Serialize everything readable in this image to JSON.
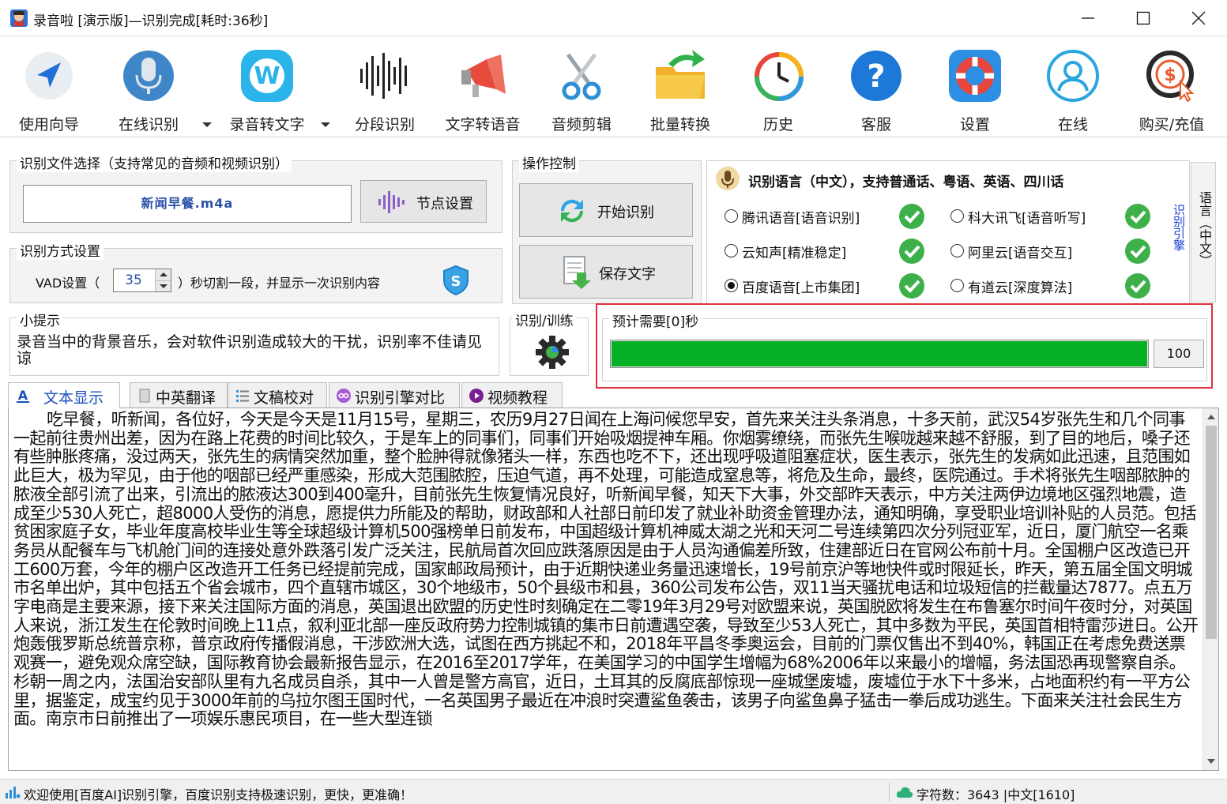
{
  "window": {
    "title": "录音啦 [演示版]—识别完成[耗时:36秒]"
  },
  "toolbar": {
    "items": [
      {
        "label": "使用向导",
        "icon": "navigation-arrow-icon"
      },
      {
        "label": "在线识别",
        "icon": "microphone-icon"
      },
      {
        "label": "录音转文字",
        "icon": "w-badge-icon"
      },
      {
        "label": "分段识别",
        "icon": "sound-wave-icon"
      },
      {
        "label": "文字转语音",
        "icon": "megaphone-icon"
      },
      {
        "label": "音频剪辑",
        "icon": "scissors-icon"
      },
      {
        "label": "批量转换",
        "icon": "folder-arrow-icon"
      },
      {
        "label": "历史",
        "icon": "history-clock-icon"
      },
      {
        "label": "客服",
        "icon": "help-question-icon"
      },
      {
        "label": "设置",
        "icon": "lifebuoy-icon"
      },
      {
        "label": "在线",
        "icon": "user-icon"
      },
      {
        "label": "购买/充值",
        "icon": "dollar-coin-icon"
      }
    ]
  },
  "file_group": {
    "title": "识别文件选择（支持常见的音频和视频识别）",
    "file_name": "新闻早餐.m4a",
    "node_button": "节点设置"
  },
  "control_group": {
    "title": "操作控制",
    "start_button": "开始识别",
    "save_button": "保存文字"
  },
  "method_group": {
    "title": "识别方式设置",
    "vad_prefix": "VAD设置（",
    "vad_value": "35",
    "vad_suffix": "）秒切割一段，并显示一次识别内容"
  },
  "tip_group": {
    "title": "小提示",
    "text": "录音当中的背景音乐，会对软件识别造成较大的干扰，识别率不佳请见谅"
  },
  "train_group": {
    "title": "识别/训练"
  },
  "language": {
    "header": "识别语言（中文），支持普通话、粤语、英语、四川话",
    "side_tab": "语言（中文）",
    "side_link": "识别引擎",
    "engines": [
      {
        "label": "腾讯语音[语音识别]",
        "selected": false,
        "available": true
      },
      {
        "label": "科大讯飞[语音听写]",
        "selected": false,
        "available": true
      },
      {
        "label": "云知声[精准稳定]",
        "selected": false,
        "available": true
      },
      {
        "label": "阿里云[语音交互]",
        "selected": false,
        "available": true
      },
      {
        "label": "百度语音[上市集团]",
        "selected": true,
        "available": true
      },
      {
        "label": "有道云[深度算法]",
        "selected": false,
        "available": true
      }
    ]
  },
  "progress": {
    "title": "预计需要[0]秒",
    "value": 100,
    "value_text": "100",
    "color": "#06b025"
  },
  "tabs": [
    {
      "label": "文本显示",
      "icon": "text-a-icon",
      "active": true
    },
    {
      "label": "中英翻译",
      "icon": "translate-doc-icon",
      "active": false
    },
    {
      "label": "文稿校对",
      "icon": "list-check-icon",
      "active": false
    },
    {
      "label": "识别引擎对比",
      "icon": "infinity-icon",
      "active": false
    },
    {
      "label": "视频教程",
      "icon": "play-circle-icon",
      "active": false
    }
  ],
  "result_text": "吃早餐，听新闻，各位好，今天是今天是11月15号，星期三，农历9月27日闻在上海问候您早安，首先来关注头条消息，十多天前，武汉54岁张先生和几个同事一起前往贵州出差，因为在路上花费的时间比较久，于是车上的同事们，同事们开始吸烟提神车厢。你烟雾缭绕，而张先生喉咙越来越不舒服，到了目的地后，嗓子还有些肿胀疼痛，没过两天，张先生的病情突然加重，整个脸肿得就像猪头一样，东西也吃不下，还出现呼吸道阻塞症状，医生表示，张先生的发病如此迅速，且范围如此巨大，极为罕见，由于他的咽部已经严重感染，形成大范围脓腔，压迫气道，再不处理，可能造成窒息等，将危及生命，最终，医院通过。手术将张先生咽部脓肿的脓液全部引流了出来，引流出的脓液达300到400毫升，目前张先生恢复情况良好，听新闻早餐，知天下大事，外交部昨天表示，中方关注两伊边境地区强烈地震，造成至少530人死亡，超8000人受伤的消息，愿提供力所能及的帮助，财政部和人社部日前印发了就业补助资金管理办法，通知明确，享受职业培训补贴的人员范。包括贫困家庭子女，毕业年度高校毕业生等全球超级计算机500强榜单日前发布，中国超级计算机神威太湖之光和天河二号连续第四次分列冠亚军，近日，厦门航空一名乘务员从配餐车与飞机舱门间的连接处意外跌落引发广泛关注，民航局首次回应跌落原因是由于人员沟通偏差所致，住建部近日在官网公布前十月。全国棚户区改造已开工600万套，今年的棚户区改造开工任务已经提前完成，国家邮政局预计，由于近期快递业务量迅速增长，19号前京沪等地快件或时限延长，昨天，第五届全国文明城市名单出炉，其中包括五个省会城市，四个直辖市城区，30个地级市，50个县级市和县，360公司发布公告，双11当天骚扰电话和垃圾短信的拦截量达7877。点五万字电商是主要来源，接下来关注国际方面的消息，英国退出欧盟的历史性时刻确定在二零19年3月29号对欧盟来说，英国脱欧将发生在布鲁塞尔时间午夜时分，对英国人来说，浙江发生在伦敦时间晚上11点，叙利亚北部一座反政府势力控制城镇的集市日前遭遇空袭，导致至少53人死亡，其中多数为平民，英国首相特雷莎进日。公开炮轰俄罗斯总统普京称，普京政府传播假消息，干涉欧洲大选，试图在西方挑起不和，2018年平昌冬季奥运会，目前的门票仅售出不到40%，韩国正在考虑免费送票观赛一，避免观众席空缺，国际教育协会最新报告显示，在2016至2017学年，在美国学习的中国学生增幅为68%2006年以来最小的增幅，务法国恐再现警察自杀。杉朝一周之内，法国治安部队里有九名成员自杀，其中一人曾是警方高官，近日，土耳其的反腐底部惊现一座城堡废墟，废墟位于水下十多米，占地面积约有一平方公里，据鉴定，成宝约见于3000年前的乌拉尔图王国时代，一名英国男子最近在冲浪时突遭鲨鱼袭击，该男子向鲨鱼鼻子猛击一拳后成功逃生。下面来关注社会民生方面。南京市日前推出了一项娱乐惠民项目，在一些大型连锁",
  "status": {
    "left": "欢迎使用[百度AI]识别引擎，百度识别支持极速识别，更快，更准确！",
    "char_count": "字符数：3643 |中文[1610]"
  }
}
